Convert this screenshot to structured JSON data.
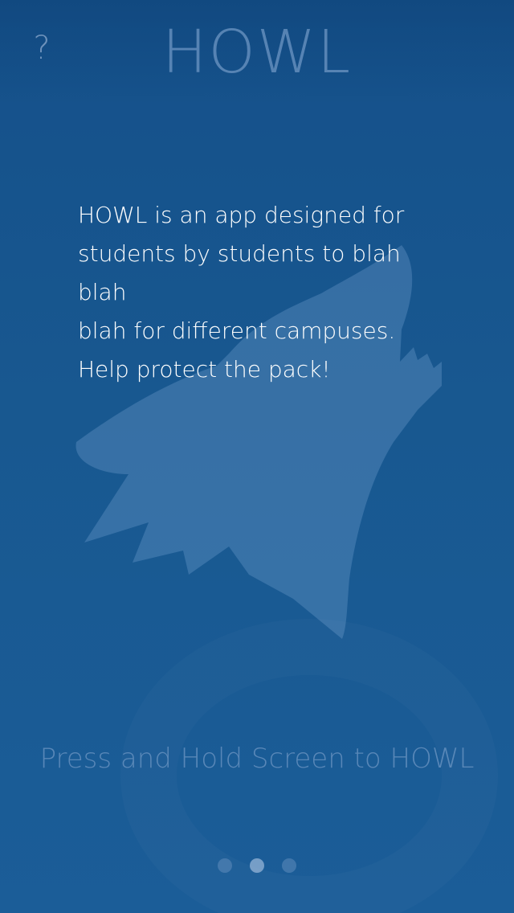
{
  "header": {
    "title": "HOWL",
    "help_label": "?"
  },
  "intro": {
    "lines": [
      "HOWL is an app designed for",
      "students by students to blah blah",
      "blah for different campuses.",
      "Help protect the pack!"
    ]
  },
  "prompt": {
    "text": "Press and Hold Screen to HOWL"
  },
  "pager": {
    "count": 3,
    "active_index": 1
  },
  "colors": {
    "background": "#15508a",
    "text": "#ffffff",
    "muted_text": "#6e96c3"
  },
  "icons": {
    "logo": "howling-wolf-icon"
  }
}
